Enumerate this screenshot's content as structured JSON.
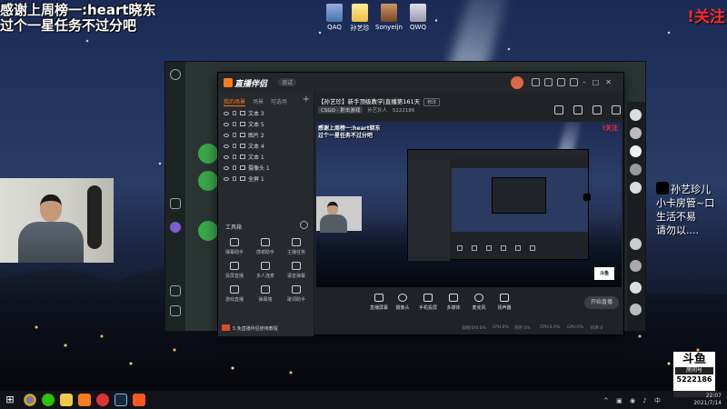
{
  "overlay": {
    "line1": "感谢上周榜一:heart晓东",
    "line2": "过个一星任务不过分吧",
    "follow": "!关注"
  },
  "desktop_icons": [
    {
      "label": "QAQ",
      "icon": "computer-icon"
    },
    {
      "label": "孙艺珍",
      "icon": "folder-icon"
    },
    {
      "label": "Sonyeijn",
      "icon": "file-icon"
    },
    {
      "label": "QWQ",
      "icon": "recycle-bin-icon"
    }
  ],
  "main_window": {
    "app_name": "直播伴侣",
    "version_tag": "测试",
    "source_tabs": [
      "我的场景",
      "场景",
      "可选场"
    ],
    "sources": [
      {
        "name": "文本 3"
      },
      {
        "name": "文本 5"
      },
      {
        "name": "图片 2"
      },
      {
        "name": "文本 4"
      },
      {
        "name": "文本 1"
      },
      {
        "name": "摄像头 1"
      },
      {
        "name": "全屏 1"
      }
    ],
    "toolbox_title": "工具箱",
    "tools": [
      {
        "label": "弹幕助手"
      },
      {
        "label": "感谢助手"
      },
      {
        "label": "主播任务"
      },
      {
        "label": "投屏直播"
      },
      {
        "label": "多人连麦"
      },
      {
        "label": "语音弹幕"
      },
      {
        "label": "游戏直播"
      },
      {
        "label": "弹幕墙"
      },
      {
        "label": "歌词助手"
      }
    ],
    "promo_text": "5.免直播伴侣使用教程",
    "room_title": "【孙艺珍】新手顶级教学|直播第161天",
    "room_tag": "修改",
    "room_category": "CSGO - 射击游戏",
    "room_host": "孙艺珍人",
    "room_id": "5222186",
    "bottom_buttons": [
      {
        "label": "直播屏幕"
      },
      {
        "label": "摄像头"
      },
      {
        "label": "手机投屏"
      },
      {
        "label": "多媒体"
      },
      {
        "label": "麦克风"
      },
      {
        "label": "扬声器"
      }
    ],
    "start_button": "开始直播",
    "stats": [
      "丢帧(0)0.0%",
      "CPU:0%",
      "内存:0%",
      "CPU:0.0%",
      "GPU:0%",
      "码率:0"
    ]
  },
  "preview": {
    "line1": "感谢上周榜一:heart晓东",
    "line2": "过个一星任务不过分吧",
    "follow": "!关注",
    "badge": "斗鱼"
  },
  "side_overlay": {
    "lines": [
      "孙艺珍儿",
      "小卡房管~口",
      "生活不易",
      "请勿以...."
    ]
  },
  "room_badge": {
    "logo": "斗鱼",
    "label": "房间号",
    "number": "5222186"
  },
  "taskbar": {
    "time": "22:07",
    "date": "2021/7/14",
    "apps": [
      "windows-icon",
      "chrome-icon",
      "wechat-icon",
      "folder-icon",
      "douyu-icon",
      "netease-icon",
      "steam-icon",
      "live-companion-icon"
    ]
  },
  "colors": {
    "accent": "#ff7a1a",
    "follow_red": "#ff2a2a",
    "window_bg": "#1f2327",
    "bg_app_green": "#2a3533"
  }
}
